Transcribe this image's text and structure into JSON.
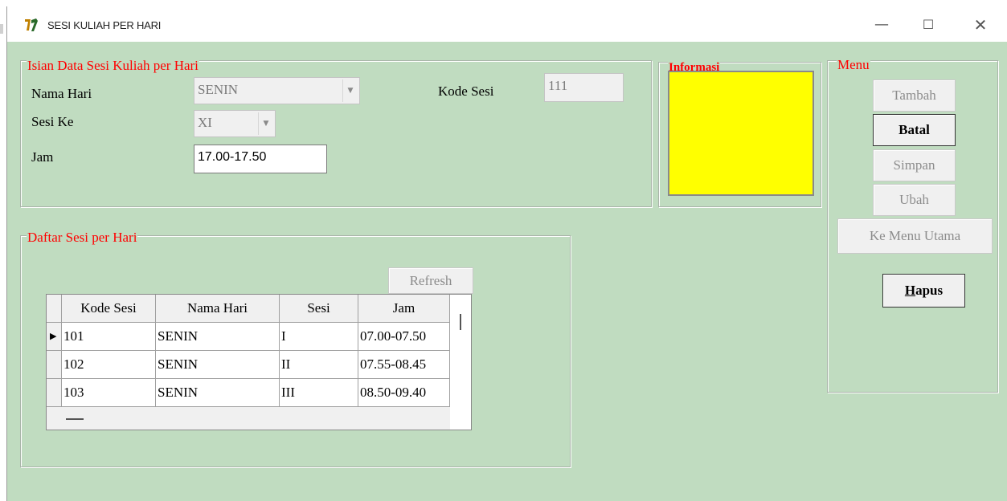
{
  "window": {
    "title": "SESI KULIAH PER HARI",
    "minimize_icon": "minimize-icon",
    "maximize_icon": "maximize-icon",
    "close_icon": "close-icon",
    "minimize_glyph": "—",
    "maximize_glyph": "☐",
    "close_glyph": "✕"
  },
  "colors": {
    "background": "#c0dcc0",
    "legend_text": "#ff0000",
    "info_panel": "#ffff00"
  },
  "isian": {
    "legend": "Isian Data Sesi Kuliah per Hari",
    "nama_hari_label": "Nama Hari",
    "nama_hari_value": "SENIN",
    "sesi_ke_label": "Sesi Ke",
    "sesi_ke_value": "XI",
    "jam_label": "Jam",
    "jam_value": "17.00-17.50",
    "kode_sesi_label": "Kode  Sesi",
    "kode_sesi_value": "111"
  },
  "informasi": {
    "legend": "Informasi"
  },
  "menu": {
    "legend": "Menu",
    "tambah": "Tambah",
    "batal": "Batal",
    "simpan": "Simpan",
    "ubah": "Ubah",
    "ke_menu_utama": "Ke Menu Utama",
    "hapus_first": "H",
    "hapus_rest": "apus"
  },
  "daftar": {
    "legend": "Daftar Sesi per Hari",
    "refresh": "Refresh",
    "columns": [
      "Kode Sesi",
      "Nama Hari",
      "Sesi",
      "Jam"
    ],
    "rows": [
      {
        "kode": "101",
        "hari": "SENIN",
        "sesi": "I",
        "jam": "07.00-07.50"
      },
      {
        "kode": "102",
        "hari": "SENIN",
        "sesi": "II",
        "jam": "07.55-08.45"
      },
      {
        "kode": "103",
        "hari": "SENIN",
        "sesi": "III",
        "jam": "08.50-09.40"
      }
    ],
    "current_row_indicator": "▶"
  }
}
